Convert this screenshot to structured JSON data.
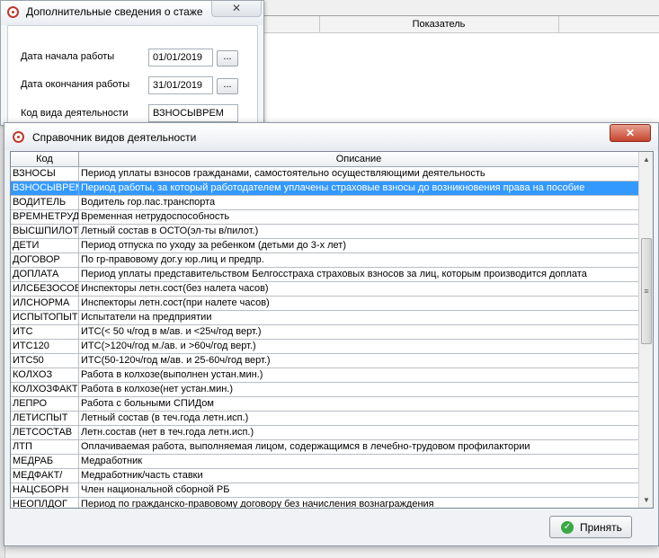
{
  "background": {
    "table_header_title": "Показатель"
  },
  "stazh_dialog": {
    "title": "Дополнительные сведения о стаже",
    "close_glyph": "✕",
    "start_label": "Дата начала работы",
    "start_value": "01/01/2019",
    "end_label": "Дата окончания работы",
    "end_value": "31/01/2019",
    "activity_label": "Код вида деятельности",
    "activity_value": "ВЗНОСЫВРЕМ",
    "dots_label": "..."
  },
  "activity_dialog": {
    "title": "Справочник видов деятельности",
    "close_glyph": "✕",
    "columns": {
      "code": "Код",
      "description": "Описание"
    },
    "selected_index": 1,
    "rows": [
      {
        "code": "ВЗНОСЫ",
        "description": "Период уплаты взносов гражданами, самостоятельно осуществляющими деятельность"
      },
      {
        "code": "ВЗНОСЫВРЕМ",
        "description": "Период работы, за который работодателем уплачены страховые взносы до возникновения права на пособие"
      },
      {
        "code": "ВОДИТЕЛЬ",
        "description": "Водитель гор.пас.транспорта"
      },
      {
        "code": "ВРЕМНЕТРУД",
        "description": "Временная нетрудоспособность"
      },
      {
        "code": "ВЫСШПИЛОТ",
        "description": "Летный состав в ОСТО(эл-ты в/пилот.)"
      },
      {
        "code": "ДЕТИ",
        "description": "Период отпуска по уходу за ребенком (детьми до 3-х лет)"
      },
      {
        "code": "ДОГОВОР",
        "description": "По гр-правовому дог.у юр.лиц и предпр."
      },
      {
        "code": "ДОПЛАТА",
        "description": "Период уплаты представительством Белгосстраха страховых взносов за лиц, которым производится доплата"
      },
      {
        "code": "ИЛСБЕЗОСОБ",
        "description": "Инспекторы летн.сост(без налета часов)"
      },
      {
        "code": "ИЛСНОРМА",
        "description": "Инспекторы летн.сост(при налете часов)"
      },
      {
        "code": "ИСПЫТОПЫТ",
        "description": "Испытатели на предприятии"
      },
      {
        "code": "ИТС",
        "description": "ИТС(< 50 ч/год в м/ав. и <25ч/год верт.)"
      },
      {
        "code": "ИТС120",
        "description": "ИТС(>120ч/год м./ав. и >60ч/год верт.)"
      },
      {
        "code": "ИТС50",
        "description": "ИТС(50-120ч/год м/ав. и 25-60ч/год верт.)"
      },
      {
        "code": "КОЛХОЗ",
        "description": "Работа в колхозе(выполнен устан.мин.)"
      },
      {
        "code": "КОЛХОЗФАКТ",
        "description": "Работа в колхозе(нет устан.мин.)"
      },
      {
        "code": "ЛЕПРО",
        "description": "Работа с больными СПИДом"
      },
      {
        "code": "ЛЕТИСПЫТ",
        "description": "Летный состав (в теч.года летн.исп.)"
      },
      {
        "code": "ЛЕТСОСТАВ",
        "description": "Летн.состав (нет в теч.года летн.исп.)"
      },
      {
        "code": "ЛТП",
        "description": "Оплачиваемая работа, выполняемая лицом, содержащимся в лечебно-трудовом профилактории"
      },
      {
        "code": "МЕДРАБ",
        "description": "Медработник"
      },
      {
        "code": "МЕДФАКТ/",
        "description": "Медработник/часть ставки"
      },
      {
        "code": "НАЦСБОРН",
        "description": "Член национальной сборной РБ"
      },
      {
        "code": "НЕОПЛДОГ",
        "description": "Период по гражданско-правовому договору без начисления вознаграждения"
      }
    ],
    "scroll_up_glyph": "▲",
    "scroll_down_glyph": "▼",
    "scroll_thumb_glyph": "≡",
    "accept_label": "Принять",
    "accept_icon_glyph": "✓"
  }
}
